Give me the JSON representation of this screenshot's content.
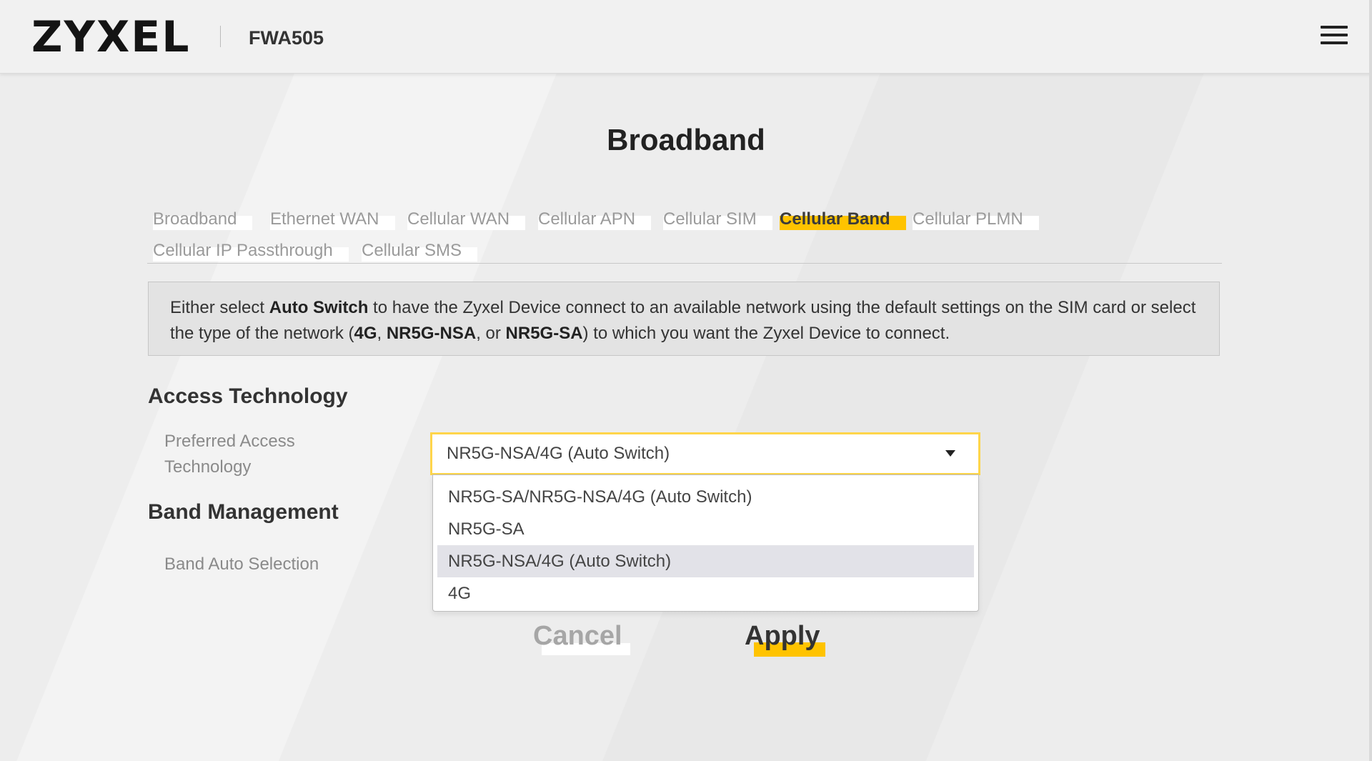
{
  "header": {
    "logo": "ZYXEL",
    "model": "FWA505",
    "menu_icon": "hamburger-menu-icon"
  },
  "page": {
    "title": "Broadband"
  },
  "tabs": [
    {
      "label": "Broadband",
      "active": false
    },
    {
      "label": "Ethernet WAN",
      "active": false
    },
    {
      "label": "Cellular WAN",
      "active": false
    },
    {
      "label": "Cellular APN",
      "active": false
    },
    {
      "label": "Cellular SIM",
      "active": false
    },
    {
      "label": "Cellular Band",
      "active": true
    },
    {
      "label": "Cellular PLMN",
      "active": false
    },
    {
      "label": "Cellular IP Passthrough",
      "active": false
    },
    {
      "label": "Cellular SMS",
      "active": false
    }
  ],
  "info": {
    "part1": "Either select ",
    "auto_switch": "Auto Switch",
    "part2": " to have the Zyxel Device connect to an available network using the default settings on the SIM card or select the type of the network (",
    "opt_4g": "4G",
    "sep1": ", ",
    "opt_nsa": "NR5G-NSA",
    "sep2": ", or ",
    "opt_sa": "NR5G-SA",
    "part3": ") to which you want the Zyxel Device to connect."
  },
  "access_technology": {
    "heading": "Access Technology",
    "preferred_label": "Preferred Access Technology",
    "selected_value": "NR5G-NSA/4G (Auto Switch)",
    "options": [
      "NR5G-SA/NR5G-NSA/4G (Auto Switch)",
      "NR5G-SA",
      "NR5G-NSA/4G (Auto Switch)",
      "4G"
    ],
    "highlighted_option_index": 2
  },
  "band_management": {
    "heading": "Band Management",
    "auto_selection_label": "Band Auto Selection"
  },
  "actions": {
    "cancel": "Cancel",
    "apply": "Apply"
  },
  "colors": {
    "accent": "#ffc300",
    "focus_border": "#ffd54a",
    "background": "#ededed"
  }
}
